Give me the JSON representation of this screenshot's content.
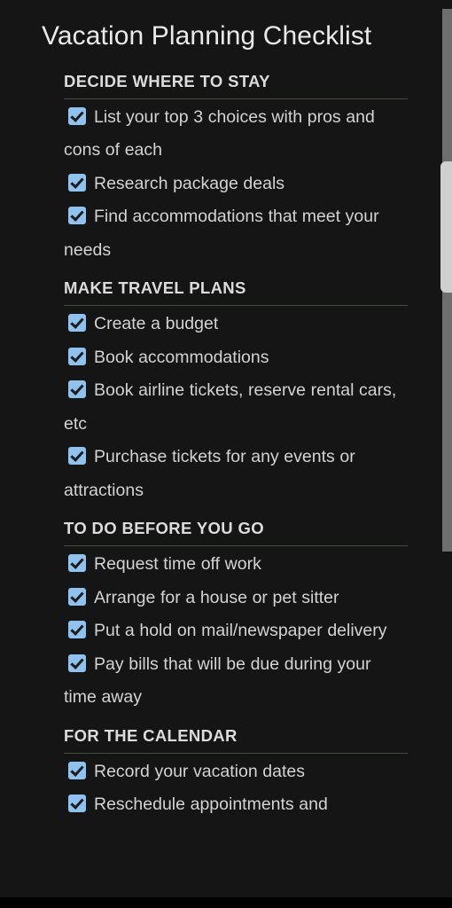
{
  "page": {
    "title": "Vacation Planning Checklist",
    "background_color": "#151515",
    "text_color": "#d3d3d3",
    "title_color": "#e9e9e9",
    "heading_color": "#dcdcdc",
    "rule_color": "#414d3e",
    "checkbox_color": "#8fc2ef",
    "checkbox_check_color": "#1d1d1d",
    "scrollbar_track_color": "#6e6e6e",
    "scrollbar_thumb_color": "#cfcfcf"
  },
  "sections": [
    {
      "heading": "DECIDE WHERE TO STAY",
      "items": [
        {
          "checked": true,
          "label": "List your top 3 choices with pros and cons of each"
        },
        {
          "checked": true,
          "label": "Research package deals"
        },
        {
          "checked": true,
          "label": "Find accommodations that meet your needs"
        }
      ]
    },
    {
      "heading": "MAKE TRAVEL PLANS",
      "items": [
        {
          "checked": true,
          "label": "Create a budget"
        },
        {
          "checked": true,
          "label": "Book accommodations"
        },
        {
          "checked": true,
          "label": "Book airline tickets, reserve rental cars, etc"
        },
        {
          "checked": true,
          "label": "Purchase tickets for any events or attractions"
        }
      ]
    },
    {
      "heading": "TO DO BEFORE YOU GO",
      "items": [
        {
          "checked": true,
          "label": "Request time off work"
        },
        {
          "checked": true,
          "label": "Arrange for a house or pet sitter"
        },
        {
          "checked": true,
          "label": "Put a hold on mail/newspaper delivery"
        },
        {
          "checked": true,
          "label": "Pay bills that will be due during your time away"
        }
      ]
    },
    {
      "heading": "FOR THE CALENDAR",
      "items": [
        {
          "checked": true,
          "label": "Record your vacation dates"
        },
        {
          "checked": true,
          "label": "Reschedule appointments and"
        }
      ]
    }
  ],
  "scrollbar": {
    "name": "vertical-scrollbar",
    "thumb_position_percent": 30
  }
}
